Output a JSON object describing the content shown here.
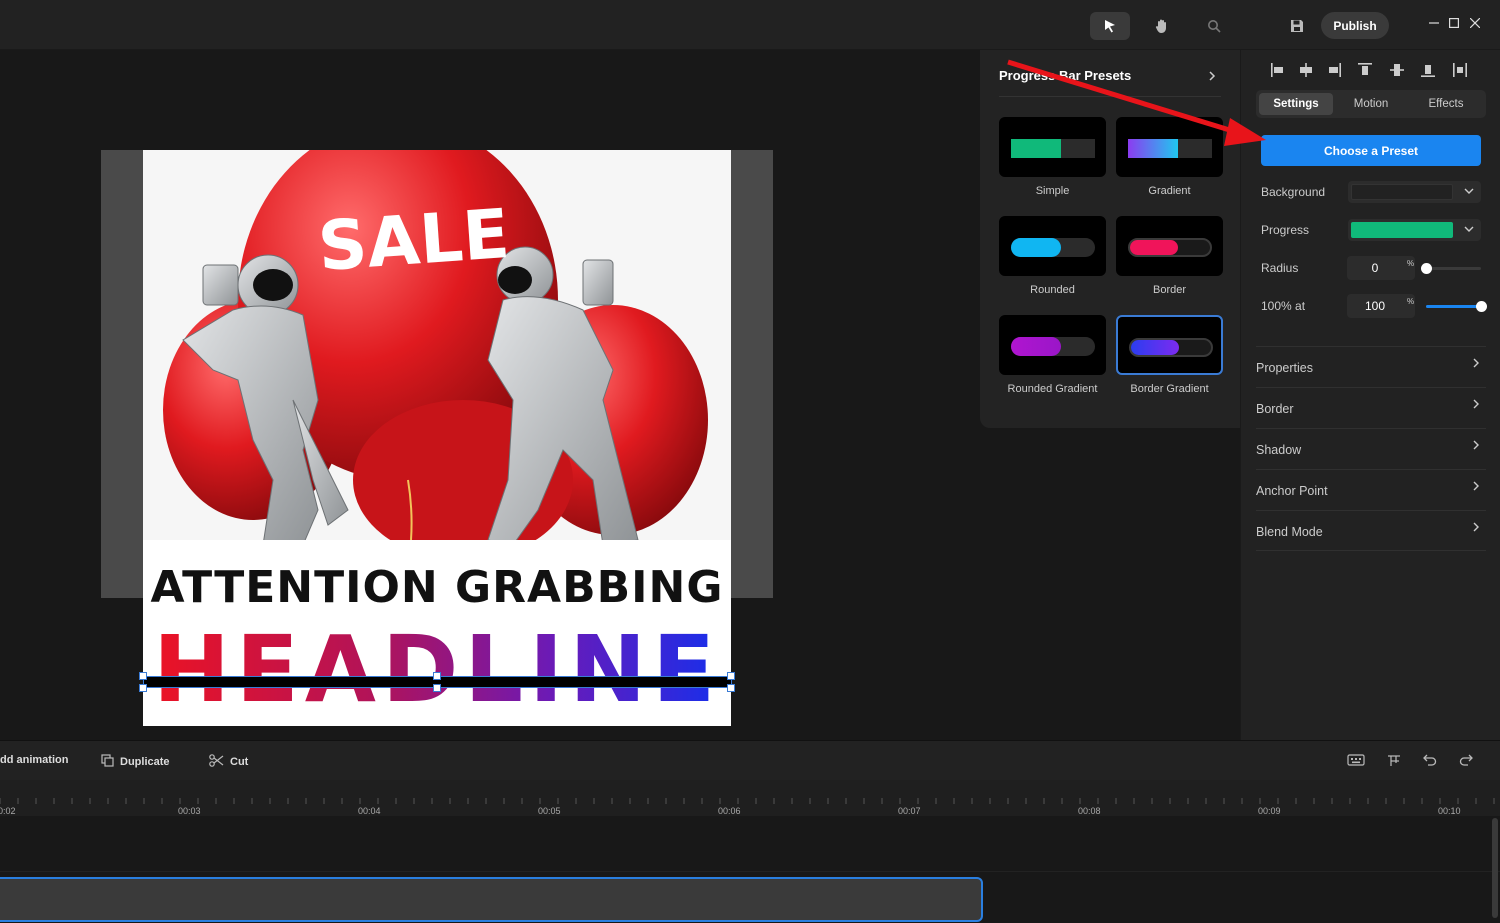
{
  "topbar": {
    "tools": [
      "select-pointer-icon",
      "hand-pan-icon",
      "zoom-search-icon"
    ],
    "save_icon": "save-icon",
    "publish_label": "Publish",
    "window_controls": [
      "minimize-icon",
      "maximize-icon",
      "close-icon"
    ]
  },
  "canvas": {
    "headline_line1": "ATTENTION GRABBING",
    "headline_line2": "HEADLINE",
    "image_text": "SALE"
  },
  "presets": {
    "title": "Progress Bar Presets",
    "items": [
      {
        "label": "Simple",
        "fill_color": "#10b97a",
        "fill_fraction": 0.6,
        "style": "simple"
      },
      {
        "label": "Gradient",
        "fill_color": "linear-gradient(90deg,#8b3cf0,#20c8f0)",
        "fill_fraction": 0.6,
        "style": "simple"
      },
      {
        "label": "Rounded",
        "fill_color": "#10b6f2",
        "fill_fraction": 0.6,
        "style": "rounded"
      },
      {
        "label": "Border",
        "fill_color": "#f0145a",
        "fill_fraction": 0.6,
        "style": "border"
      },
      {
        "label": "Rounded Gradient",
        "fill_color": "linear-gradient(90deg,#b015d0,#9a16c8)",
        "fill_fraction": 0.6,
        "style": "rounded"
      },
      {
        "label": "Border Gradient",
        "fill_color": "linear-gradient(90deg,#2b3df0,#7d2bf0)",
        "fill_fraction": 0.6,
        "style": "border",
        "selected": true
      }
    ]
  },
  "inspector": {
    "tabs": [
      "Settings",
      "Motion",
      "Effects"
    ],
    "active_tab": "Settings",
    "choose_preset_label": "Choose a Preset",
    "background_label": "Background",
    "background_color": "#222222",
    "progress_label": "Progress",
    "progress_color": "#10b97a",
    "radius_label": "Radius",
    "radius_value": "0",
    "radius_unit": "%",
    "radius_fraction": 0.0,
    "hundred_label": "100% at",
    "hundred_value": "100",
    "hundred_unit": "%",
    "hundred_fraction": 1.0,
    "sections": [
      "Properties",
      "Border",
      "Shadow",
      "Anchor Point",
      "Blend Mode"
    ]
  },
  "bottom_toolbar": {
    "add_animation": "dd animation",
    "duplicate": "Duplicate",
    "cut": "Cut"
  },
  "timeline": {
    "ticks": [
      "00:02",
      "00:03",
      "00:04",
      "00:05",
      "00:06",
      "00:07",
      "00:08",
      "00:09",
      "00:10"
    ]
  },
  "colors": {
    "accent": "#1a85f0",
    "annotation_arrow": "#e8141a"
  }
}
